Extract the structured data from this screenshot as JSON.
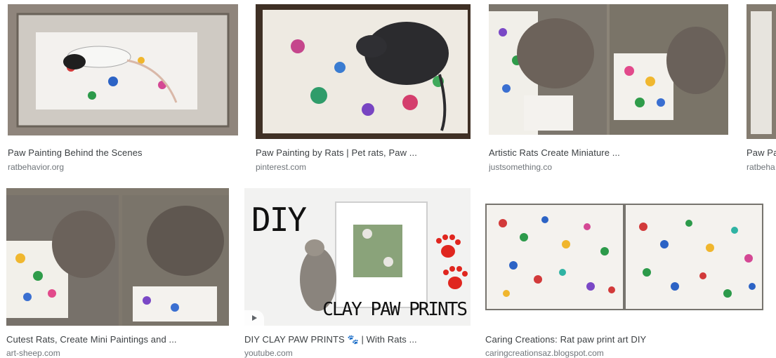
{
  "results": [
    {
      "title": "Paw Painting Behind the Scenes",
      "source": "ratbehavior.org"
    },
    {
      "title": "Paw Painting by Rats | Pet rats, Paw ...",
      "source": "pinterest.com"
    },
    {
      "title": "Artistic Rats Create Miniature ...",
      "source": "justsomething.co"
    },
    {
      "title": "Paw Pa",
      "source": "ratbeha"
    },
    {
      "title": "Cutest Rats, Create Mini Paintings and ...",
      "source": "art-sheep.com"
    },
    {
      "title": "DIY CLAY PAW PRINTS 🐾 | With Rats ...",
      "source": "youtube.com",
      "thumb_text_top": "DIY",
      "thumb_text_bottom": "CLAY PAW PRINTS"
    },
    {
      "title": "Caring Creations: Rat paw print art DIY",
      "source": "caringcreationsaz.blogspot.com"
    }
  ],
  "icons": {
    "play": "play-icon",
    "paw": "paw-print-icon"
  },
  "colors": {
    "title": "#3c4043",
    "source": "#70757a",
    "paw_red": "#e0261f"
  }
}
